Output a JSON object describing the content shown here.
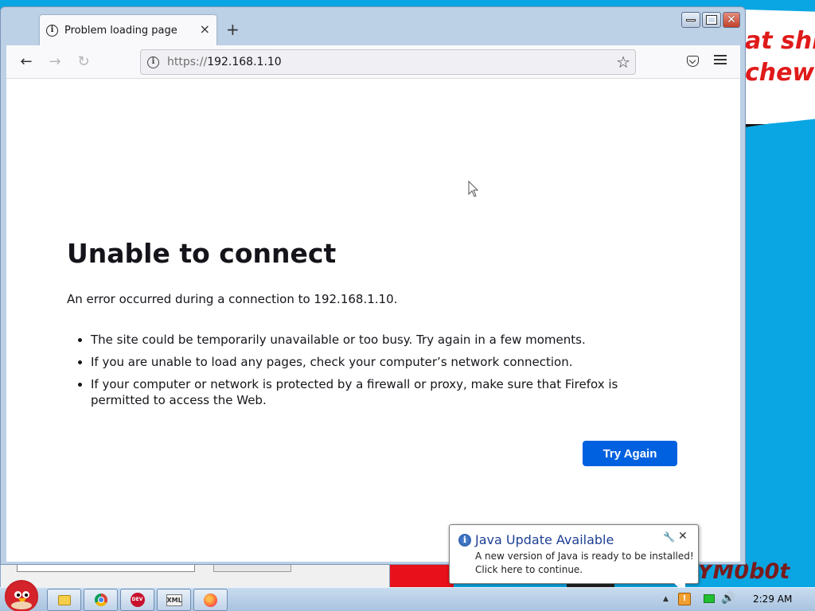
{
  "browser": {
    "tab": {
      "title": "Problem loading page",
      "close_glyph": "×"
    },
    "new_tab_glyph": "+",
    "window_controls": {
      "close_glyph": "✕"
    },
    "nav": {
      "back_glyph": "←",
      "forward_glyph": "→",
      "reload_glyph": "↻"
    },
    "url": {
      "scheme": "https://",
      "host": "192.168.1.10"
    },
    "bookmark_glyph": "☆"
  },
  "error_page": {
    "title": "Unable to connect",
    "description": "An error occurred during a connection to 192.168.1.10.",
    "bullets": [
      "The site could be temporarily unavailable or too busy. Try again in a few moments.",
      "If you are unable to load any pages, check your computer’s network connection.",
      "If your computer or network is protected by a firewall or proxy, make sure that Firefox is permitted to access the Web."
    ],
    "try_again_label": "Try Again"
  },
  "java_notification": {
    "title": "Java Update Available",
    "body": "A new version of Java is ready to be installed! Click here to continue.",
    "close_glyph": "✕",
    "settings_glyph": "🔧"
  },
  "desktop": {
    "wallpaper_lines": [
      "at shit",
      "chew"
    ],
    "signature": "YM0b0t"
  },
  "taskbar": {
    "apps": [
      "explorer-icon",
      "chrome-icon",
      "devcpp-icon",
      "xml-editor-icon",
      "firefox-icon"
    ],
    "devcpp_label": "DEV C++",
    "xml_label": "XML",
    "clock": "2:29 AM",
    "tray_arrow_glyph": "▲",
    "volume_glyph": "🔊"
  },
  "colors": {
    "accent": "#0061e0",
    "desktop": "#0aa6e3",
    "wallpaper_text": "#e01a1a"
  }
}
